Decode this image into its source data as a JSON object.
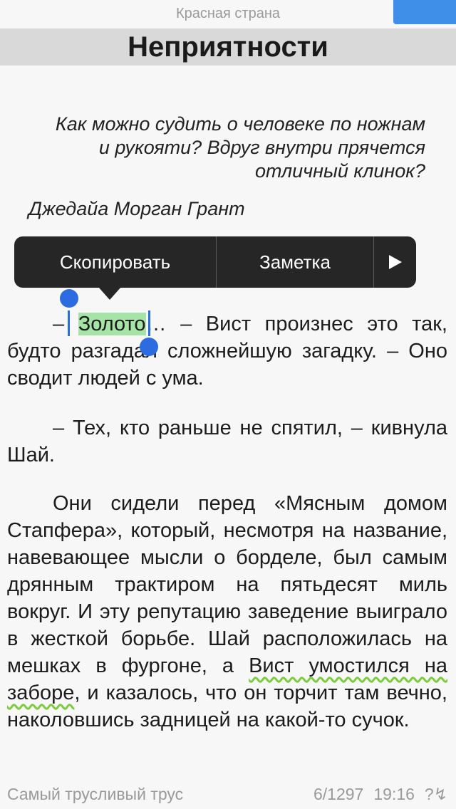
{
  "header": {
    "book_title": "Красная страна",
    "chapter_title": "Неприятности"
  },
  "epigraph": {
    "text": "Как можно судить о человеке по ножнам и рукояти? Вдруг внутри пря­чется отличный клинок?",
    "author": "Джедайа Морган Грант"
  },
  "context_menu": {
    "copy_label": "Скопировать",
    "note_label": "Заметка",
    "more_icon": "play-triangle"
  },
  "body": {
    "p1_dash": "–",
    "p1_selected": "Золото",
    "p1_rest": "… – Вист произнес это так, будто разгадал сложнейшую загадку. – Оно сводит людей с ума.",
    "p2": "– Тех, кто раньше не спятил, – кив­нула Шай.",
    "p3_before": "Они сидели перед «Мясным домом Стапфера», который, несмотря на на­звание, навевающее мысли о борделе, был самым дрянным трактиром на пять­десят миль вокруг. И эту репутацию за­ведение выиграло в жесткой борьбе. Шай расположилась на мешках в фур­гоне, а ",
    "p3_squiggle": "Вист умостился на заборе",
    "p3_after": ", и ка­залось, что он торчит там вечно, нако­ловшись задницей на какой-то сучок."
  },
  "footer": {
    "chapter_name": "Самый трусливый трус",
    "page_position": "6/1297",
    "time": "19:16",
    "status_icons": "?↯"
  },
  "colors": {
    "selection": "#a6e3a6",
    "handle": "#2c6ce0",
    "bookmark": "#3f8ee8",
    "menu_bg": "#262626"
  }
}
